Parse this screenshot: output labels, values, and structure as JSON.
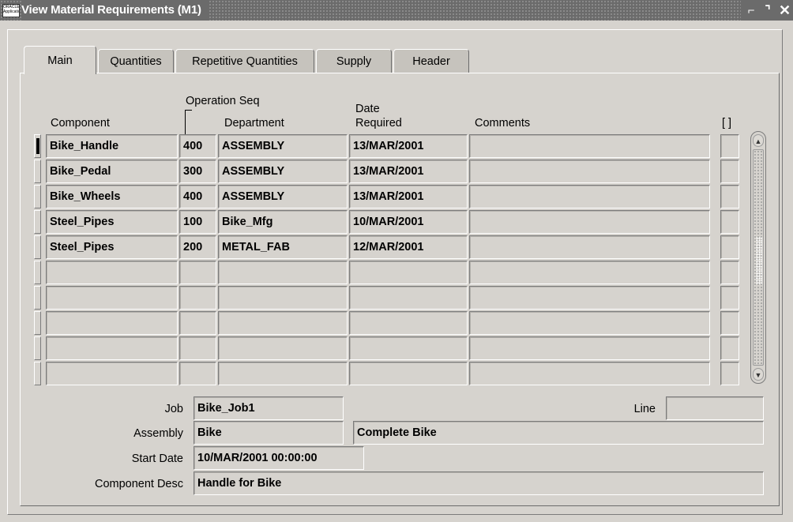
{
  "window": {
    "title": "View Material Requirements (M1)",
    "app_icon_text": "ORACLE Applications",
    "controls": {
      "minimize": "⌐",
      "maximize": "⌝",
      "close": "✕"
    }
  },
  "tabs": [
    {
      "label": "Main",
      "active": true
    },
    {
      "label": "Quantities",
      "active": false
    },
    {
      "label": "Repetitive Quantities",
      "active": false
    },
    {
      "label": "Supply",
      "active": false
    },
    {
      "label": "Header",
      "active": false
    }
  ],
  "grid": {
    "headers": {
      "component": "Component",
      "operation_seq": "Operation Seq",
      "department": "Department",
      "date_line1": "Date",
      "date_line2": "Required",
      "comments": "Comments",
      "flex": "[ ]"
    },
    "rows": [
      {
        "component": "Bike_Handle",
        "op_seq": "400",
        "department": "ASSEMBLY",
        "date_required": "13/MAR/2001",
        "comments": ""
      },
      {
        "component": "Bike_Pedal",
        "op_seq": "300",
        "department": "ASSEMBLY",
        "date_required": "13/MAR/2001",
        "comments": ""
      },
      {
        "component": "Bike_Wheels",
        "op_seq": "400",
        "department": "ASSEMBLY",
        "date_required": "13/MAR/2001",
        "comments": ""
      },
      {
        "component": "Steel_Pipes",
        "op_seq": "100",
        "department": "Bike_Mfg",
        "date_required": "10/MAR/2001",
        "comments": ""
      },
      {
        "component": "Steel_Pipes",
        "op_seq": "200",
        "department": "METAL_FAB",
        "date_required": "12/MAR/2001",
        "comments": ""
      },
      {
        "component": "",
        "op_seq": "",
        "department": "",
        "date_required": "",
        "comments": ""
      },
      {
        "component": "",
        "op_seq": "",
        "department": "",
        "date_required": "",
        "comments": ""
      },
      {
        "component": "",
        "op_seq": "",
        "department": "",
        "date_required": "",
        "comments": ""
      },
      {
        "component": "",
        "op_seq": "",
        "department": "",
        "date_required": "",
        "comments": ""
      },
      {
        "component": "",
        "op_seq": "",
        "department": "",
        "date_required": "",
        "comments": ""
      }
    ]
  },
  "form": {
    "job_label": "Job",
    "job_value": "Bike_Job1",
    "line_label": "Line",
    "line_value": "",
    "assembly_label": "Assembly",
    "assembly_value": "Bike",
    "assembly_desc": "Complete Bike",
    "start_date_label": "Start Date",
    "start_date_value": "10/MAR/2001 00:00:00",
    "component_desc_label": "Component Desc",
    "component_desc_value": "Handle for Bike"
  },
  "icons": {
    "scroll_up": "▲",
    "scroll_down": "▼"
  }
}
